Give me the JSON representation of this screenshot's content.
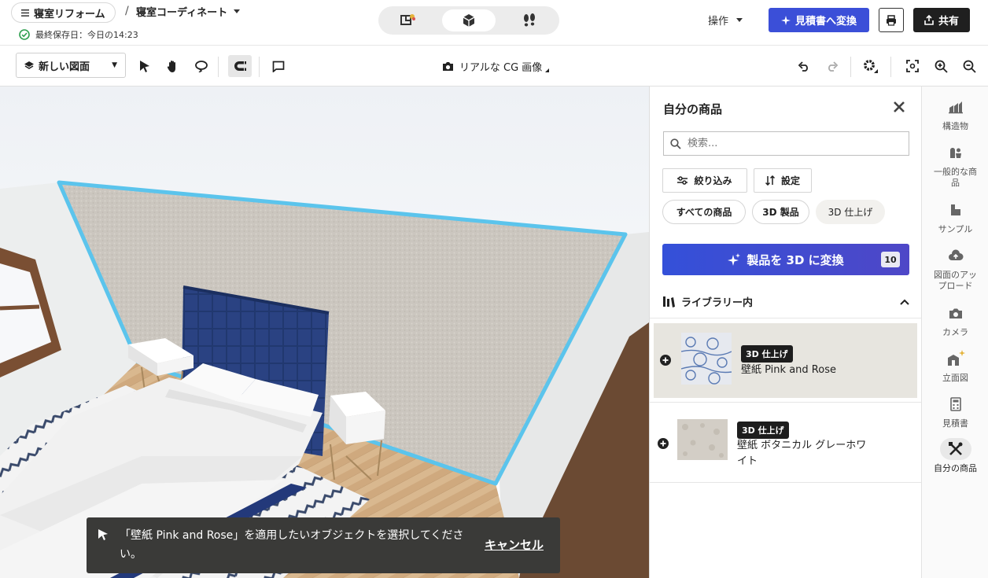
{
  "header": {
    "project": "寝室リフォーム",
    "separator": "/",
    "room": "寝室コーディネート",
    "saved": "最終保存日：今日の14:23",
    "operations": "操作",
    "estimate_button": "見積書へ変換",
    "share_button": "共有"
  },
  "toolbar": {
    "plan_select": "新しい図面",
    "render_label": "リアルな CG 画像"
  },
  "toast": {
    "message": "「壁紙 Pink and Rose」を適用したいオブジェクトを選択してください。",
    "cancel": "キャンセル"
  },
  "panel": {
    "title": "自分の商品",
    "search_placeholder": "検索...",
    "filter_button": "絞り込み",
    "settings_button": "設定",
    "chips": [
      "すべての商品",
      "3D 製品",
      "3D 仕上げ"
    ],
    "convert_button": "製品を 3D に変換",
    "convert_count": "10",
    "library_header": "ライブラリー内",
    "items": [
      {
        "badge": "3D 仕上げ",
        "name": "壁紙 Pink and Rose"
      },
      {
        "badge": "3D 仕上げ",
        "name": "壁紙 ボタニカル グレーホワイト"
      }
    ]
  },
  "rail": {
    "items": [
      {
        "label": "構造物",
        "icon": "structure-icon"
      },
      {
        "label": "一般的な商品",
        "icon": "general-products-icon"
      },
      {
        "label": "サンプル",
        "icon": "sample-icon"
      },
      {
        "label": "図面のアップロード",
        "icon": "cloud-upload-icon"
      },
      {
        "label": "カメラ",
        "icon": "camera-icon"
      },
      {
        "label": "立面図",
        "icon": "elevation-icon"
      },
      {
        "label": "見積書",
        "icon": "calculator-icon"
      },
      {
        "label": "自分の商品",
        "icon": "my-products-icon"
      }
    ]
  },
  "colors": {
    "primary": "#3b4fd8",
    "selection_outline": "#5bc4ec",
    "toast_bg": "#3a3a38",
    "headboard": "#233a73"
  }
}
